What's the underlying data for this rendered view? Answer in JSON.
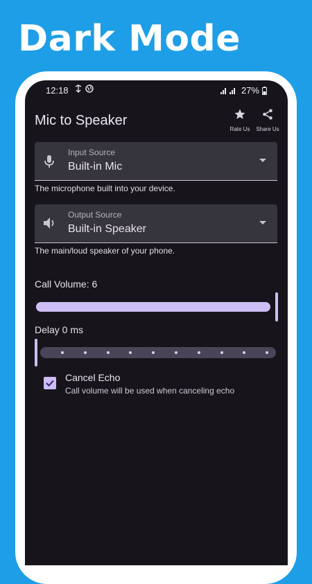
{
  "headline": "Dark Mode",
  "status": {
    "time": "12:18",
    "battery": "27%"
  },
  "app": {
    "title": "Mic to Speaker",
    "actions": [
      {
        "label": "Rate Us",
        "icon": "star-icon"
      },
      {
        "label": "Share Us",
        "icon": "share-icon"
      }
    ]
  },
  "input_source": {
    "label": "Input Source",
    "value": "Built-in Mic",
    "helper": "The microphone built into your device.",
    "icon": "microphone-icon"
  },
  "output_source": {
    "label": "Output Source",
    "value": "Built-in Speaker",
    "helper": "The main/loud speaker of your phone.",
    "icon": "speaker-icon"
  },
  "call_volume": {
    "label": "Call Volume: 6",
    "value": 6,
    "fraction": 1.0
  },
  "delay": {
    "label": "Delay 0 ms",
    "value": 0,
    "fraction": 0.0
  },
  "cancel_echo": {
    "title": "Cancel Echo",
    "subtitle": "Call volume will be used when canceling echo",
    "checked": true
  },
  "colors": {
    "background": "#1e9ee6",
    "surface": "#17151b",
    "field": "#36343c",
    "accent": "#cdbdf5"
  }
}
